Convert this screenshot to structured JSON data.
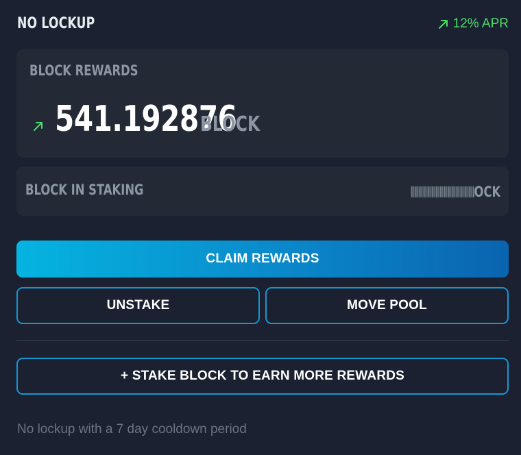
{
  "pool": {
    "title": "NO LOCKUP",
    "apr": "12% APR",
    "apr_icon": "arrow-up-right-icon",
    "accent_green": "#4ade6a"
  },
  "rewards": {
    "label": "BLOCK REWARDS",
    "amount": "541.192876",
    "unit": "BLOCK",
    "trend_icon": "arrow-up-right-icon"
  },
  "staking": {
    "label": "BLOCK IN STAKING",
    "unit_partial": "LOCK"
  },
  "actions": {
    "claim_label": "CLAIM REWARDS",
    "unstake_label": "UNSTAKE",
    "move_pool_label": "MOVE POOL",
    "stake_label": "+ STAKE BLOCK TO EARN MORE REWARDS"
  },
  "footnote": "No lockup with a 7 day cooldown period",
  "colors": {
    "background": "#1b2130",
    "card": "#232a36",
    "accent_blue": "#1696d2",
    "muted_text": "#8d96a3"
  }
}
